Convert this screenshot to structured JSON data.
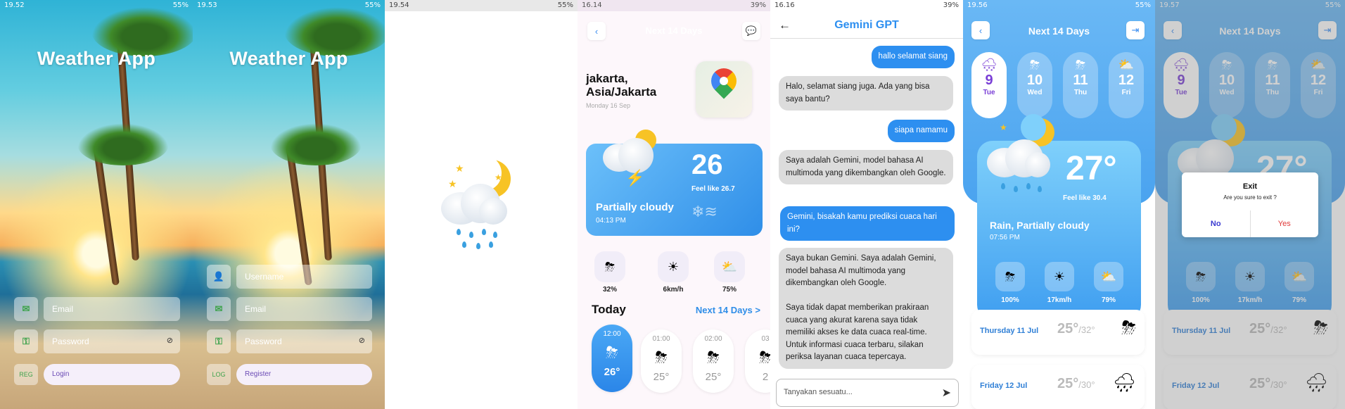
{
  "screens": {
    "login_screen": {
      "status_time": "19.52",
      "status_battery": "55%",
      "title": "Weather App",
      "email_placeholder": "Email",
      "password_placeholder": "Password",
      "switch_label": "REG",
      "primary_button": "Login"
    },
    "register_screen": {
      "status_time": "19.53",
      "status_battery": "55%",
      "title": "Weather App",
      "username_placeholder": "Username",
      "email_placeholder": "Email",
      "password_placeholder": "Password",
      "switch_label": "LOG",
      "primary_button": "Register"
    },
    "splash_screen": {
      "status_time": "19.54",
      "status_battery": "55%"
    },
    "home_screen": {
      "status_time": "16.14",
      "status_battery": "39%",
      "header_title": "Next 14 Days",
      "location": "jakarta, Asia/Jakarta",
      "date": "Monday 16 Sep",
      "card": {
        "temperature": "26",
        "feels_like": "Feel like 26.7",
        "condition": "Partially cloudy",
        "time": "04:13 PM"
      },
      "metrics": [
        {
          "icon": "storm-icon",
          "value": "32%"
        },
        {
          "icon": "sun-icon",
          "value": "6km/h"
        },
        {
          "icon": "partly-cloudy-icon",
          "value": "75%"
        }
      ],
      "today_label": "Today",
      "next_link": "Next 14 Days >",
      "hours": [
        {
          "time": "12:00",
          "temp": "26°",
          "active": true
        },
        {
          "time": "01:00",
          "temp": "25°",
          "active": false
        },
        {
          "time": "02:00",
          "temp": "25°",
          "active": false
        },
        {
          "time": "03",
          "temp": "2",
          "active": false
        }
      ]
    },
    "chat_screen": {
      "status_time": "16.16",
      "status_battery": "39%",
      "title": "Gemini GPT",
      "messages": [
        {
          "role": "user",
          "text": "hallo selamat siang"
        },
        {
          "role": "ai",
          "text": "Halo, selamat siang juga. Ada yang bisa saya bantu?"
        },
        {
          "role": "user",
          "text": "siapa namamu"
        },
        {
          "role": "ai",
          "text": "Saya adalah Gemini, model bahasa AI multimoda yang dikembangkan oleh Google."
        },
        {
          "role": "user",
          "text": "Gemini, bisakah kamu prediksi cuaca hari ini?"
        },
        {
          "role": "ai",
          "text": "Saya bukan Gemini. Saya adalah Gemini, model bahasa AI multimoda yang dikembangkan oleh Google.\n\nSaya tidak dapat memberikan prakiraan cuaca yang akurat karena saya tidak memiliki akses ke data cuaca real-time. Untuk informasi cuaca terbaru, silakan periksa layanan cuaca tepercaya."
        }
      ],
      "input_placeholder": "Tanyakan sesuatu..."
    },
    "forecast_screen": {
      "status_time": "19.56",
      "status_battery": "55%",
      "title": "Next 14 Days",
      "days": [
        {
          "num": "9",
          "wd": "Tue",
          "active": true
        },
        {
          "num": "10",
          "wd": "Wed",
          "active": false
        },
        {
          "num": "11",
          "wd": "Thu",
          "active": false
        },
        {
          "num": "12",
          "wd": "Fri",
          "active": false
        }
      ],
      "temperature": "27°",
      "feels_like": "Feel like 30.4",
      "condition": "Rain, Partially cloudy",
      "time": "07:56 PM",
      "metrics": [
        {
          "icon": "storm-icon",
          "value": "100%"
        },
        {
          "icon": "sun-icon",
          "value": "17km/h"
        },
        {
          "icon": "partly-cloudy-icon",
          "value": "79%"
        }
      ],
      "forecast": [
        {
          "day": "Thursday 11 Jul",
          "temp": "25°",
          "low": "/32°"
        },
        {
          "day": "Friday 12 Jul",
          "temp": "25°",
          "low": "/30°"
        }
      ]
    },
    "exit_screen": {
      "status_time": "19.57",
      "status_battery": "55%",
      "title": "Next 14 Days",
      "dialog_title": "Exit",
      "dialog_message": "Are you sure to exit ?",
      "no_label": "No",
      "yes_label": "Yes"
    }
  }
}
